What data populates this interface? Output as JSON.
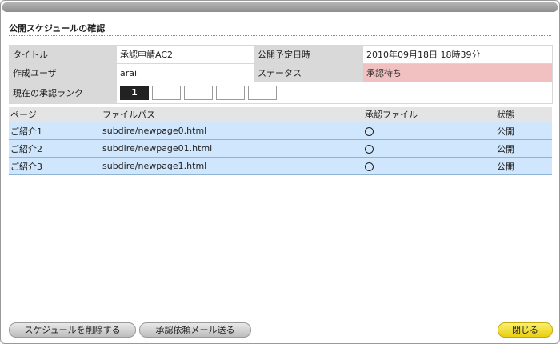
{
  "dialog": {
    "heading": "公開スケジュールの確認"
  },
  "info": {
    "title_label": "タイトル",
    "title_value": "承認申請AC2",
    "scheduled_label": "公開予定日時",
    "scheduled_value": "2010年09月18日 18時39分",
    "creator_label": "作成ユーザ",
    "creator_value": "arai",
    "status_label": "ステータス",
    "status_value": "承認待ち",
    "status_color": "#f1c1c1",
    "rank_label": "現在の承認ランク",
    "rank_boxes": [
      "1",
      "",
      "",
      "",
      ""
    ]
  },
  "pages": {
    "headers": {
      "page": "ページ",
      "path": "ファイルパス",
      "approval_file": "承認ファイル",
      "state": "状態"
    },
    "rows": [
      {
        "page": "ご紹介1",
        "path": "subdire/newpage0.html",
        "approval_icon": "circle-icon",
        "state": "公開"
      },
      {
        "page": "ご紹介2",
        "path": "subdire/newpage01.html",
        "approval_icon": "circle-icon",
        "state": "公開"
      },
      {
        "page": "ご紹介3",
        "path": "subdire/newpage1.html",
        "approval_icon": "circle-icon",
        "state": "公開"
      }
    ],
    "row_color": "#cfe6fc"
  },
  "buttons": {
    "delete_schedule": "スケジュールを削除する",
    "send_request_mail": "承認依頼メール送る",
    "close": "閉じる",
    "close_color": "#f3de30"
  }
}
